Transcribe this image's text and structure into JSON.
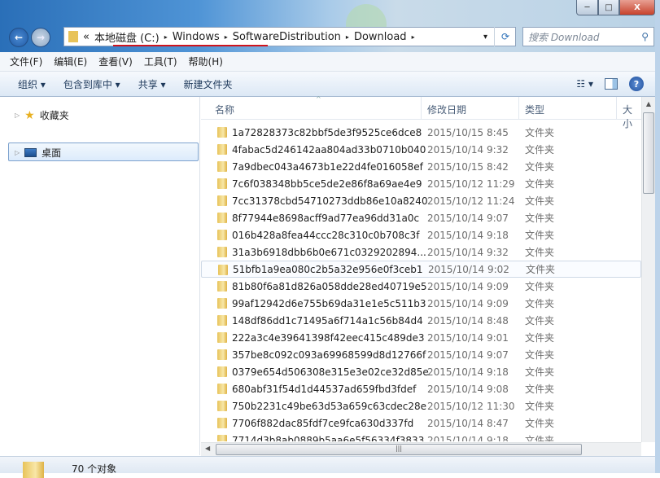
{
  "window": {
    "controls": {
      "minimize": "─",
      "maximize": "□",
      "close": "X"
    }
  },
  "address": {
    "overflow": "«",
    "crumbs": [
      "本地磁盘 (C:)",
      "Windows",
      "SoftwareDistribution",
      "Download"
    ],
    "separator": "▸",
    "dropdown": "▾",
    "refresh": "⟳"
  },
  "search": {
    "placeholder": "搜索 Download",
    "icon": "search-icon"
  },
  "menu": [
    "文件(F)",
    "编辑(E)",
    "查看(V)",
    "工具(T)",
    "帮助(H)"
  ],
  "toolbar": {
    "organize": "组织 ▾",
    "include_library": "包含到库中 ▾",
    "share": "共享 ▾",
    "new_folder": "新建文件夹",
    "views": "☷ ▾",
    "help": "?"
  },
  "sidebar": {
    "favorites": "收藏夹",
    "desktop": "桌面"
  },
  "columns": {
    "name": "名称",
    "date": "修改日期",
    "type": "类型",
    "size": "大小"
  },
  "files": [
    {
      "name": "1a72828373c82bbf5de3f9525ce6dce8",
      "date": "2015/10/15 8:45",
      "type": "文件夹"
    },
    {
      "name": "4fabac5d246142aa804ad33b0710b040",
      "date": "2015/10/14 9:32",
      "type": "文件夹"
    },
    {
      "name": "7a9dbec043a4673b1e22d4fe016058ef",
      "date": "2015/10/15 8:42",
      "type": "文件夹"
    },
    {
      "name": "7c6f038348bb5ce5de2e86f8a69ae4e9",
      "date": "2015/10/12 11:29",
      "type": "文件夹"
    },
    {
      "name": "7cc31378cbd54710273ddb86e10a8240",
      "date": "2015/10/12 11:24",
      "type": "文件夹"
    },
    {
      "name": "8f77944e8698acff9ad77ea96dd31a0c",
      "date": "2015/10/14 9:07",
      "type": "文件夹"
    },
    {
      "name": "016b428a8fea44ccc28c310c0b708c3f",
      "date": "2015/10/14 9:18",
      "type": "文件夹"
    },
    {
      "name": "31a3b6918dbb6b0e671c0329202894...",
      "date": "2015/10/14 9:32",
      "type": "文件夹"
    },
    {
      "name": "51bfb1a9ea080c2b5a32e956e0f3ceb1",
      "date": "2015/10/14 9:02",
      "type": "文件夹"
    },
    {
      "name": "81b80f6a81d826a058dde28ed40719e5",
      "date": "2015/10/14 9:09",
      "type": "文件夹"
    },
    {
      "name": "99af12942d6e755b69da31e1e5c511b3",
      "date": "2015/10/14 9:09",
      "type": "文件夹"
    },
    {
      "name": "148df86dd1c71495a6f714a1c56b84d4",
      "date": "2015/10/14 8:48",
      "type": "文件夹"
    },
    {
      "name": "222a3c4e39641398f42eec415c489de3",
      "date": "2015/10/14 9:01",
      "type": "文件夹"
    },
    {
      "name": "357be8c092c093a69968599d8d12766f",
      "date": "2015/10/14 9:07",
      "type": "文件夹"
    },
    {
      "name": "0379e654d506308e315e3e02ce32d85e",
      "date": "2015/10/14 9:18",
      "type": "文件夹"
    },
    {
      "name": "680abf31f54d1d44537ad659fbd3fdef",
      "date": "2015/10/14 9:08",
      "type": "文件夹"
    },
    {
      "name": "750b2231c49be63d53a659c63cdec28e",
      "date": "2015/10/12 11:30",
      "type": "文件夹"
    },
    {
      "name": "7706f882dac85fdf7ce9fca630d337fd",
      "date": "2015/10/14 8:47",
      "type": "文件夹"
    },
    {
      "name": "7714d3b8ab0889b5aa6e5f56334f3833",
      "date": "2015/10/14 9:18",
      "type": "文件夹"
    }
  ],
  "highlighted_row": 8,
  "status": {
    "count": "70 个对象"
  }
}
